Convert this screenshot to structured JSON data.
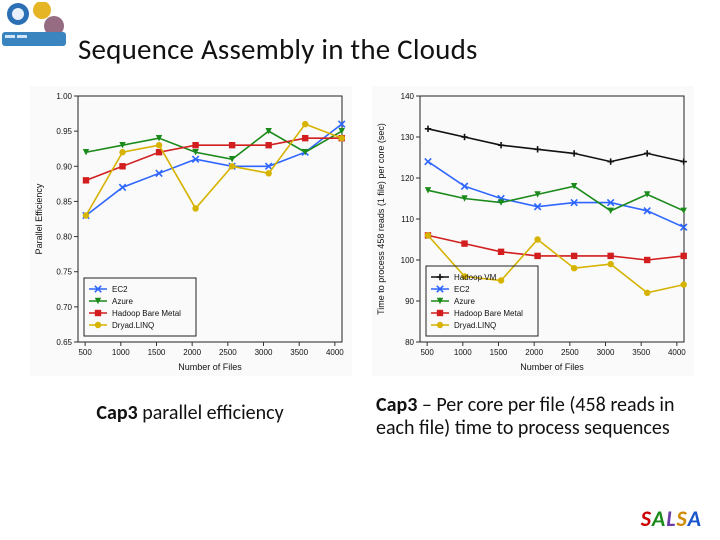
{
  "header": {
    "title": "Sequence Assembly in the Clouds"
  },
  "captions": {
    "left_bold": "Cap3",
    "left_rest": " parallel efficiency",
    "right_bold": "Cap3",
    "right_rest": " – Per core per file (458 reads in each file) time to process sequences"
  },
  "footer": {
    "brand": "SALSA"
  },
  "chart_data": [
    {
      "type": "line",
      "title": "",
      "xlabel": "Number of Files",
      "ylabel": "Parallel Efficiency",
      "x": [
        512,
        1024,
        1536,
        2048,
        2560,
        3072,
        3584,
        4096
      ],
      "xlim": [
        400,
        4100
      ],
      "ylim": [
        0.65,
        1.0
      ],
      "yticks": [
        0.65,
        0.7,
        0.75,
        0.8,
        0.85,
        0.9,
        0.95,
        1.0
      ],
      "legend_position": "lower-left",
      "series": [
        {
          "name": "EC2",
          "color": "#2e66ff",
          "marker": "x",
          "values": [
            0.83,
            0.87,
            0.89,
            0.91,
            0.9,
            0.9,
            0.92,
            0.96
          ]
        },
        {
          "name": "Azure",
          "color": "#1a8a1a",
          "marker": "tri-down",
          "values": [
            0.92,
            0.93,
            0.94,
            0.92,
            0.91,
            0.95,
            0.92,
            0.95
          ]
        },
        {
          "name": "Hadoop Bare Metal",
          "color": "#d21e1e",
          "marker": "square",
          "values": [
            0.88,
            0.9,
            0.92,
            0.93,
            0.93,
            0.93,
            0.94,
            0.94
          ]
        },
        {
          "name": "Dryad.LINQ",
          "color": "#d6b300",
          "marker": "circle",
          "values": [
            0.83,
            0.92,
            0.93,
            0.84,
            0.9,
            0.89,
            0.96,
            0.94
          ]
        }
      ]
    },
    {
      "type": "line",
      "title": "",
      "xlabel": "Number of Files",
      "ylabel": "Time to process 458 reads  (1 file) per core (sec)",
      "x": [
        512,
        1024,
        1536,
        2048,
        2560,
        3072,
        3584,
        4096
      ],
      "xlim": [
        400,
        4100
      ],
      "ylim": [
        80,
        140
      ],
      "yticks": [
        80,
        90,
        100,
        110,
        120,
        130,
        140
      ],
      "legend_position": "lower-left",
      "series": [
        {
          "name": "Hadoop VM",
          "color": "#111111",
          "marker": "tick",
          "values": [
            132,
            130,
            128,
            127,
            126,
            124,
            126,
            124
          ]
        },
        {
          "name": "EC2",
          "color": "#2e66ff",
          "marker": "x",
          "values": [
            124,
            118,
            115,
            113,
            114,
            114,
            112,
            108
          ]
        },
        {
          "name": "Azure",
          "color": "#1a8a1a",
          "marker": "tri-down",
          "values": [
            117,
            115,
            114,
            116,
            118,
            112,
            116,
            112
          ]
        },
        {
          "name": "Hadoop Bare Metal",
          "color": "#d21e1e",
          "marker": "square",
          "values": [
            106,
            104,
            102,
            101,
            101,
            101,
            100,
            101
          ]
        },
        {
          "name": "Dryad.LINQ",
          "color": "#d6b300",
          "marker": "circle",
          "values": [
            106,
            96,
            95,
            105,
            98,
            99,
            92,
            94
          ]
        }
      ]
    }
  ]
}
